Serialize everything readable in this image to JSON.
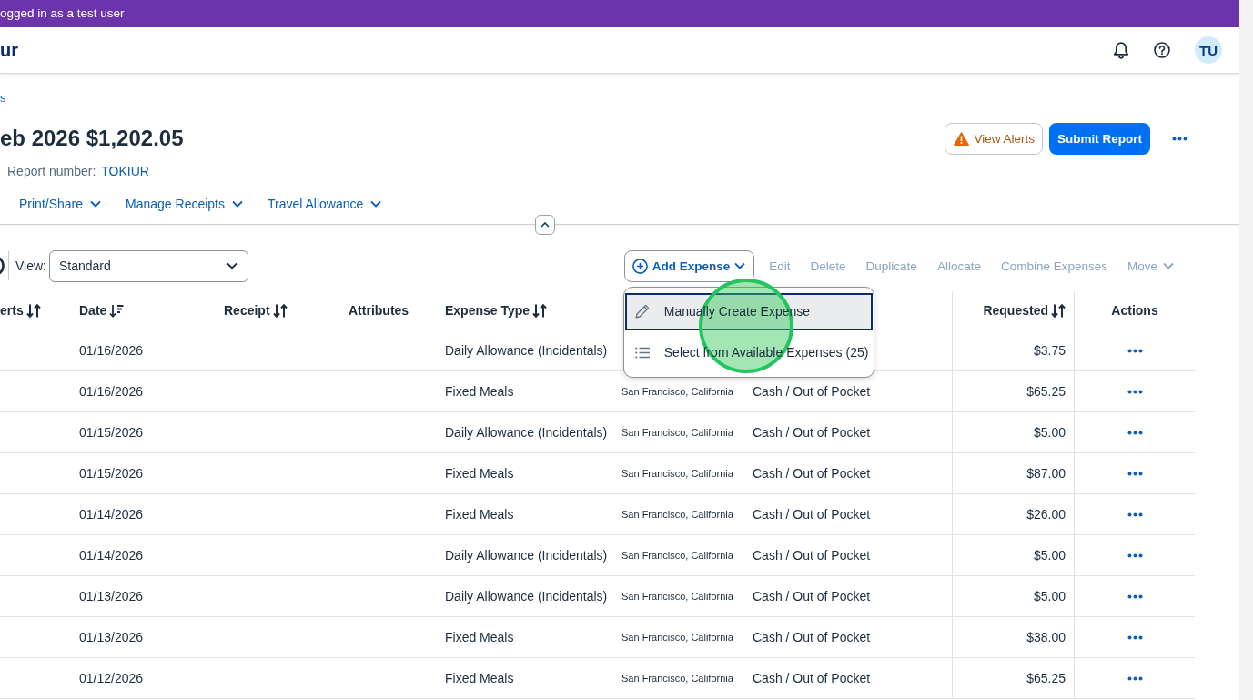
{
  "banner": {
    "text": "ogged in as a test user"
  },
  "header": {
    "logo": "ur",
    "avatar": "TU"
  },
  "breadcrumb": "s",
  "report": {
    "title": "eb 2026 $1,202.05",
    "number_label": "Report number:",
    "number": "TOKIUR",
    "buttons": [
      {
        "label": "View Alerts",
        "kind": "alert"
      },
      {
        "label": "Submit Report",
        "kind": "primary"
      }
    ]
  },
  "menus": [
    {
      "label": "Print/Share"
    },
    {
      "label": "Manage Receipts"
    },
    {
      "label": "Travel Allowance"
    }
  ],
  "toolbar": {
    "view_label": "View:",
    "view_value": "Standard",
    "add_button": {
      "label": "Add Expense",
      "expanded": true
    },
    "buttons": [
      {
        "label": "Edit",
        "disabled": true,
        "kind": "plain"
      },
      {
        "label": "Delete",
        "disabled": true,
        "kind": "plain"
      },
      {
        "label": "Duplicate",
        "disabled": true,
        "kind": "plain"
      },
      {
        "label": "Allocate",
        "disabled": true,
        "kind": "plain"
      },
      {
        "label": "Combine Expenses",
        "disabled": true,
        "kind": "plain"
      },
      {
        "label": "Move",
        "disabled": true,
        "kind": "menu"
      }
    ]
  },
  "add_menu": {
    "items": [
      {
        "label": "Manually Create Expense",
        "selected": true,
        "kind": "pencil"
      },
      {
        "label": "Select from Available Expenses (25)",
        "selected": false,
        "kind": "list"
      }
    ]
  },
  "table": {
    "columns": [
      {
        "label": "erts",
        "kind": "sortable"
      },
      {
        "label": "Date",
        "kind": "sorted"
      },
      {
        "label": "Receipt",
        "kind": "sortable"
      },
      {
        "label": "Attributes",
        "kind": "plain"
      },
      {
        "label": "Expense Type",
        "kind": "sortable"
      },
      {
        "label": "Requested",
        "kind": "sortable"
      },
      {
        "label": "Actions",
        "kind": "plain"
      }
    ],
    "rows": [
      {
        "date": "01/16/2026",
        "expense_type": "Daily Allowance (Incidentals)",
        "requested": "$3.75"
      },
      {
        "date": "01/16/2026",
        "expense_type": "Fixed Meals",
        "location": "San Francisco, California",
        "payment_type": "Cash / Out of Pocket",
        "requested": "$65.25"
      },
      {
        "date": "01/15/2026",
        "expense_type": "Daily Allowance (Incidentals)",
        "location": "San Francisco, California",
        "payment_type": "Cash / Out of Pocket",
        "requested": "$5.00"
      },
      {
        "date": "01/15/2026",
        "expense_type": "Fixed Meals",
        "location": "San Francisco, California",
        "payment_type": "Cash / Out of Pocket",
        "requested": "$87.00"
      },
      {
        "date": "01/14/2026",
        "expense_type": "Fixed Meals",
        "location": "San Francisco, California",
        "payment_type": "Cash / Out of Pocket",
        "requested": "$26.00"
      },
      {
        "date": "01/14/2026",
        "expense_type": "Daily Allowance (Incidentals)",
        "location": "San Francisco, California",
        "payment_type": "Cash / Out of Pocket",
        "requested": "$5.00"
      },
      {
        "date": "01/13/2026",
        "expense_type": "Daily Allowance (Incidentals)",
        "location": "San Francisco, California",
        "payment_type": "Cash / Out of Pocket",
        "requested": "$5.00"
      },
      {
        "date": "01/13/2026",
        "expense_type": "Fixed Meals",
        "location": "San Francisco, California",
        "payment_type": "Cash / Out of Pocket",
        "requested": "$38.00"
      },
      {
        "date": "01/12/2026",
        "expense_type": "Fixed Meals",
        "location": "San Francisco, California",
        "payment_type": "Cash / Out of Pocket",
        "requested": "$65.25"
      }
    ]
  }
}
